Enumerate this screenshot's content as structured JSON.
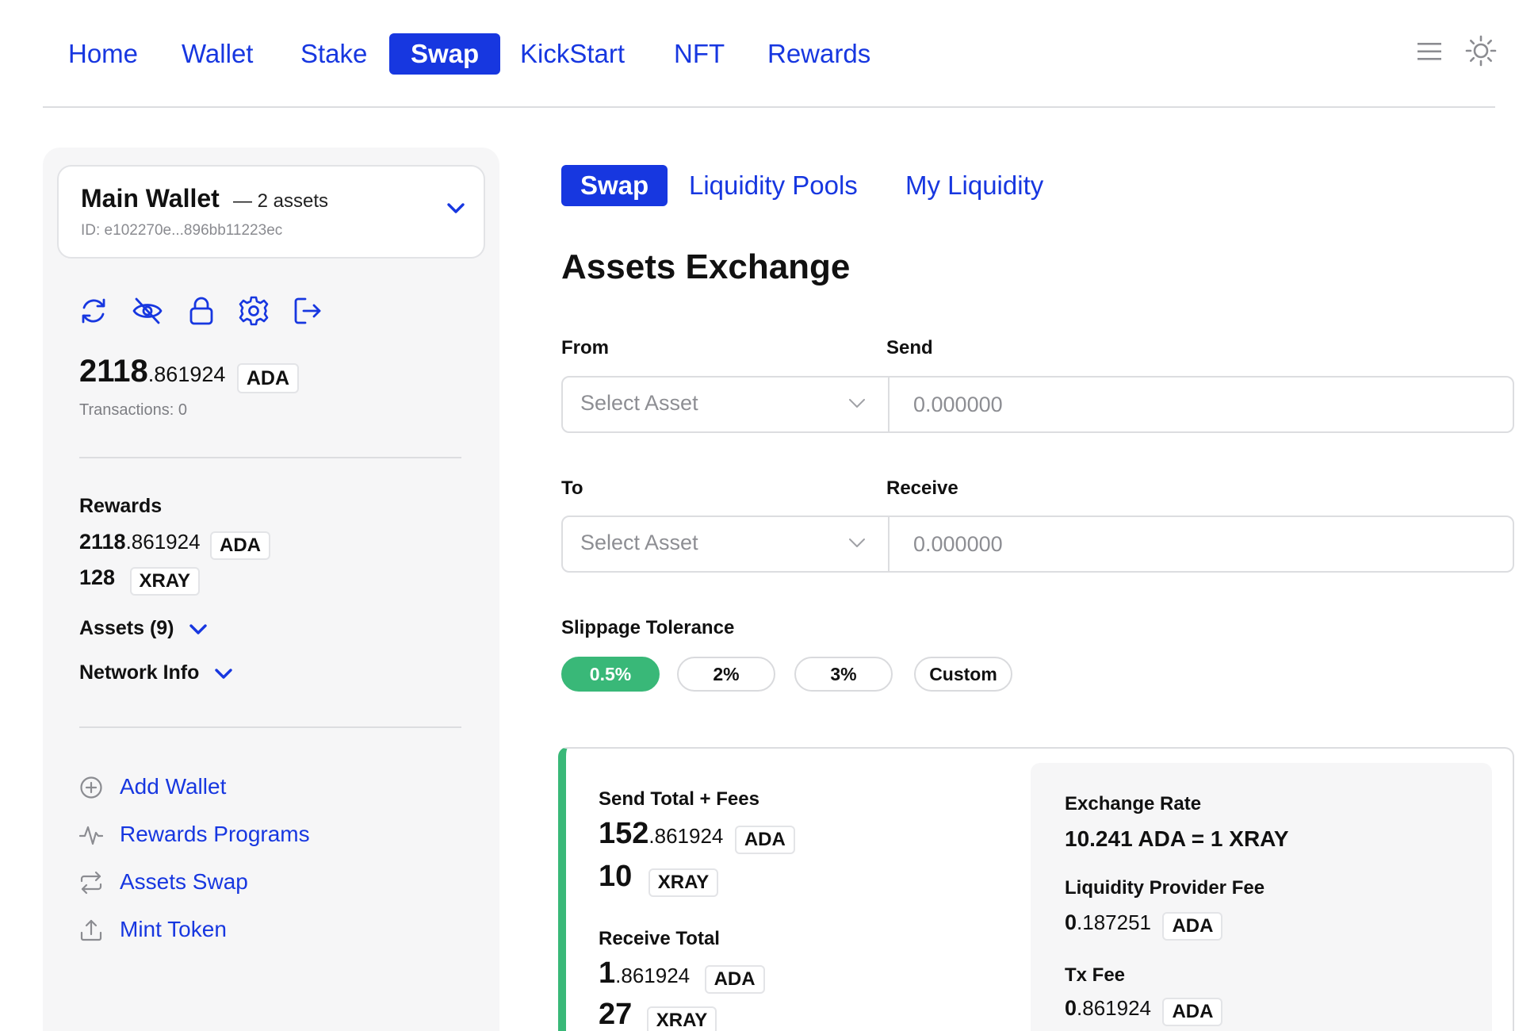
{
  "nav": {
    "items": [
      {
        "label": "Home"
      },
      {
        "label": "Wallet"
      },
      {
        "label": "Stake"
      },
      {
        "label": "Swap"
      },
      {
        "label": "KickStart"
      },
      {
        "label": "NFT"
      },
      {
        "label": "Rewards"
      }
    ],
    "active": "Swap",
    "icons": [
      "menu-icon",
      "sun-icon"
    ]
  },
  "wallet": {
    "name": "Main Wallet",
    "assets_label": "— 2 assets",
    "id": "ID: e102270e...896bb11223ec",
    "toolbar_icons": [
      "refresh-icon",
      "eye-off-icon",
      "lock-icon",
      "settings-icon",
      "logout-icon"
    ],
    "balance_int": "2118",
    "balance_frac": ".861924",
    "balance_unit": "ADA",
    "transactions": "Transactions: 0"
  },
  "rewards": {
    "title": "Rewards",
    "rows": [
      {
        "int": "2118",
        "frac": ".861924",
        "unit": "ADA"
      },
      {
        "int": "128",
        "frac": "",
        "unit": "XRAY"
      }
    ]
  },
  "sections": {
    "assets": "Assets (9)",
    "network": "Network Info"
  },
  "side_links": [
    {
      "label": "Add Wallet",
      "icon": "plus-circle-icon"
    },
    {
      "label": "Rewards Programs",
      "icon": "activity-icon"
    },
    {
      "label": "Assets Swap",
      "icon": "swap-arrows-icon"
    },
    {
      "label": "Mint Token",
      "icon": "upload-icon"
    }
  ],
  "subtabs": [
    {
      "label": "Swap"
    },
    {
      "label": "Liquidity Pools"
    },
    {
      "label": "My Liquidity"
    }
  ],
  "page_title": "Assets Exchange",
  "from": {
    "label": "From",
    "send_label": "Send",
    "select_placeholder": "Select Asset",
    "amount_placeholder": "0.000000"
  },
  "to": {
    "label": "To",
    "receive_label": "Receive",
    "select_placeholder": "Select Asset",
    "amount_placeholder": "0.000000"
  },
  "slippage": {
    "label": "Slippage Tolerance",
    "options": [
      "0.5%",
      "2%",
      "3%",
      "Custom"
    ],
    "selected": "0.5%",
    "active_color": "#39b878"
  },
  "summary": {
    "send_total_label": "Send Total + Fees",
    "send_rows": [
      {
        "int": "152",
        "frac": ".861924",
        "unit": "ADA"
      },
      {
        "int": "10",
        "frac": "",
        "unit": "XRAY"
      }
    ],
    "receive_total_label": "Receive Total",
    "receive_rows": [
      {
        "int": "1",
        "frac": ".861924",
        "unit": "ADA"
      },
      {
        "int": "27",
        "frac": "",
        "unit": "XRAY"
      }
    ],
    "exchange_rate_label": "Exchange Rate",
    "exchange_rate": "10.241 ADA = 1 XRAY",
    "lp_fee_label": "Liquidity Provider Fee",
    "lp_fee": {
      "int": "0",
      "frac": ".187251",
      "unit": "ADA"
    },
    "tx_fee_label": "Tx Fee",
    "tx_fee": {
      "int": "0",
      "frac": ".861924",
      "unit": "ADA"
    }
  },
  "colors": {
    "accent": "#1737e0",
    "green": "#39b878",
    "sidebar_bg": "#f6f6f7"
  }
}
